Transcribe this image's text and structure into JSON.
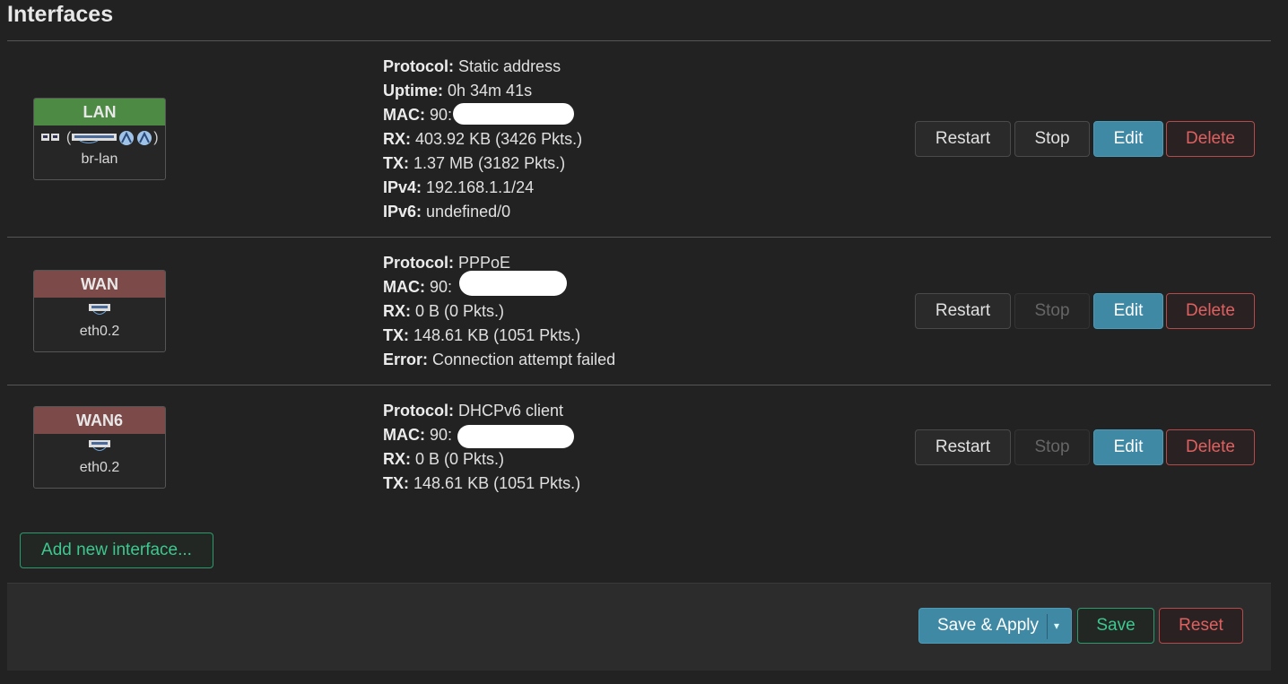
{
  "page": {
    "title": "Interfaces"
  },
  "interfaces": [
    {
      "name": "LAN",
      "device": "br-lan",
      "icons": [
        "ethernet-icon",
        "bridge-icon",
        "wifi-icon",
        "wifi-icon"
      ],
      "details": [
        {
          "label": "Protocol:",
          "value": "Static address"
        },
        {
          "label": "Uptime:",
          "value": "0h 34m 41s"
        },
        {
          "label": "MAC:",
          "value": "90:"
        },
        {
          "label": "RX:",
          "value": "403.92 KB (3426 Pkts.)"
        },
        {
          "label": "TX:",
          "value": "1.37 MB (3182 Pkts.)"
        },
        {
          "label": "IPv4:",
          "value": "192.168.1.1/24"
        },
        {
          "label": "IPv6:",
          "value": "undefined/0"
        }
      ],
      "buttons": {
        "restart": "Restart",
        "stop": "Stop",
        "edit": "Edit",
        "delete": "Delete"
      }
    },
    {
      "name": "WAN",
      "device": "eth0.2",
      "icons": [
        "ethernet-port-icon"
      ],
      "details": [
        {
          "label": "Protocol:",
          "value": "PPPoE"
        },
        {
          "label": "MAC:",
          "value": "90:"
        },
        {
          "label": "RX:",
          "value": "0 B (0 Pkts.)"
        },
        {
          "label": "TX:",
          "value": "148.61 KB (1051 Pkts.)"
        },
        {
          "label": "Error:",
          "value": "Connection attempt failed"
        }
      ],
      "buttons": {
        "restart": "Restart",
        "stop": "Stop",
        "edit": "Edit",
        "delete": "Delete"
      }
    },
    {
      "name": "WAN6",
      "device": "eth0.2",
      "icons": [
        "ethernet-port-icon"
      ],
      "details": [
        {
          "label": "Protocol:",
          "value": "DHCPv6 client"
        },
        {
          "label": "MAC:",
          "value": "90:"
        },
        {
          "label": "RX:",
          "value": "0 B (0 Pkts.)"
        },
        {
          "label": "TX:",
          "value": "148.61 KB (1051 Pkts.)"
        }
      ],
      "buttons": {
        "restart": "Restart",
        "stop": "Stop",
        "edit": "Edit",
        "delete": "Delete"
      }
    }
  ],
  "add_button": "Add new interface...",
  "footer": {
    "save_apply": "Save & Apply",
    "dropdown": "▾",
    "save": "Save",
    "reset": "Reset"
  },
  "colors": {
    "background": "#222222",
    "lan_header": "#4d8a43",
    "wan_header": "#7d4a4a",
    "edit_button": "#3f89a5",
    "delete_border": "#b44a4a",
    "save_green": "#3cc88f"
  }
}
